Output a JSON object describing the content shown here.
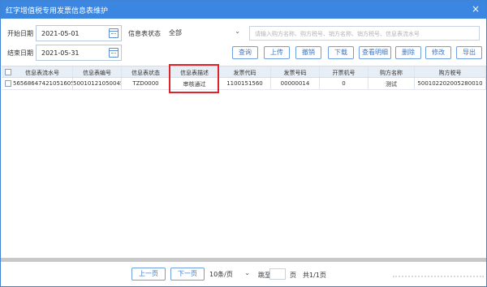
{
  "window": {
    "title": "红字增值税专用发票信息表维护",
    "close_glyph": "×"
  },
  "filters": {
    "start_date_label": "开始日期",
    "start_date": "2021-05-01",
    "end_date_label": "结束日期",
    "end_date": "2021-05-31",
    "status_label": "信息表状态",
    "status_value": "全部",
    "search_placeholder": "请输入购方名称、购方税号、销方名称、销方税号、信息表流水号"
  },
  "toolbar": {
    "query": "查询",
    "upload": "上传",
    "revoke": "撤销",
    "download": "下载",
    "view_detail": "查看明细",
    "delete": "删除",
    "modify": "修改",
    "export": "导出"
  },
  "table": {
    "columns": [
      "信息表流水号",
      "信息表编号",
      "信息表状态",
      "信息表描述",
      "发票代码",
      "发票号码",
      "开票机号",
      "购方名称",
      "购方税号"
    ],
    "rows": [
      {
        "serial": "565686474210516054",
        "number": "5001012105004582",
        "status": "TZD0000",
        "description": "审核通过",
        "invoice_code": "1100151560",
        "invoice_number": "00000014",
        "machine_no": "0",
        "buyer_name": "测试",
        "buyer_tax_id": "500102202005280010"
      }
    ]
  },
  "pager": {
    "prev": "上一页",
    "next": "下一页",
    "page_size": "10条/页",
    "goto_label": "跳至",
    "page_unit": "页",
    "total": "共1/1页"
  }
}
